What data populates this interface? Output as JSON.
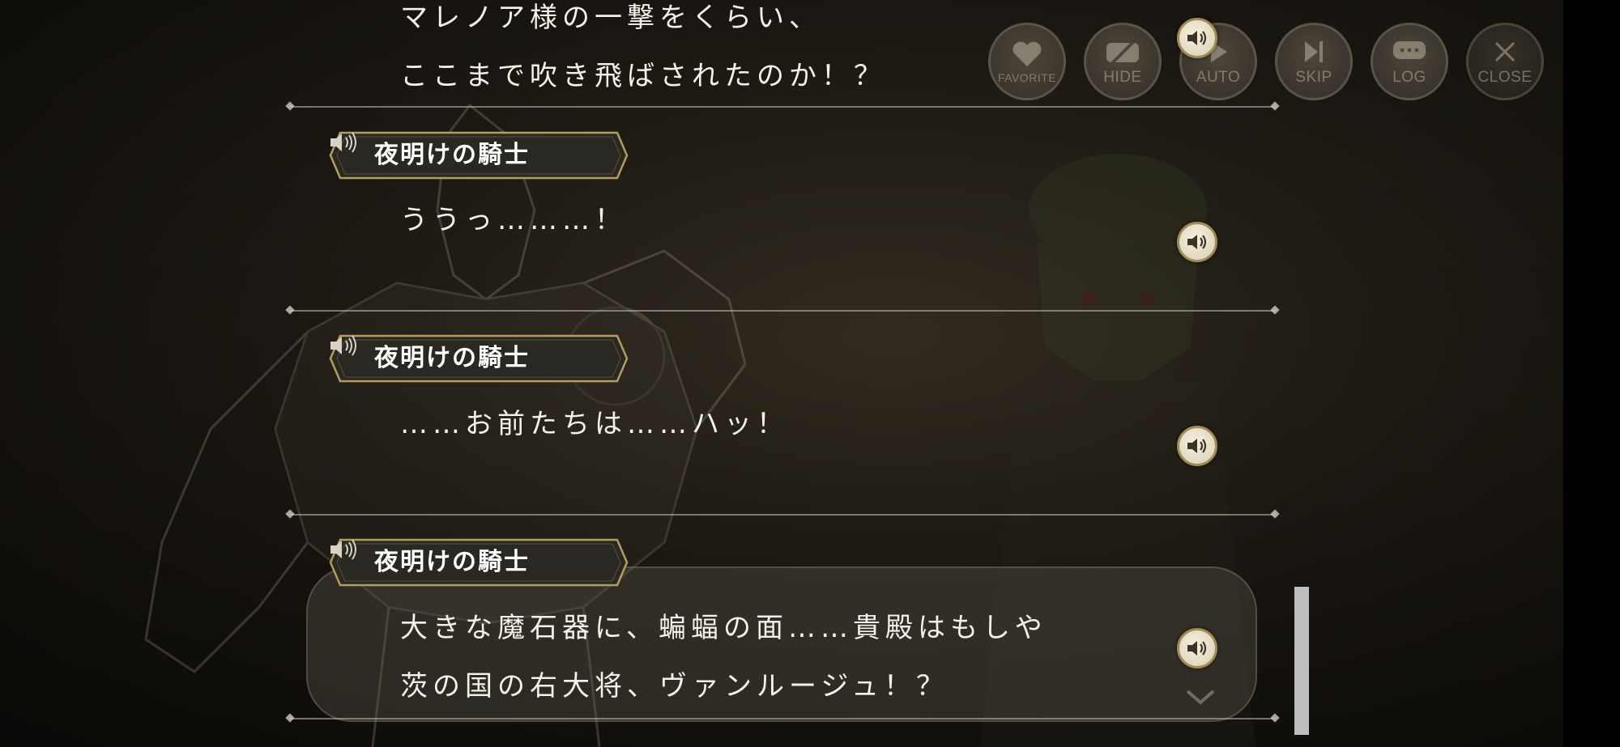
{
  "toolbar": {
    "favorite": "FAVORITE",
    "hide": "HIDE",
    "auto": "AUTO",
    "skip": "SKIP",
    "log": "LOG",
    "close": "CLOSE"
  },
  "log": {
    "entry0": {
      "line1": "マレノア様の一撃をくらい、",
      "line2": "ここまで吹き飛ばされたのか！？"
    },
    "entry1": {
      "speaker": "夜明けの騎士",
      "line1": "ううっ………！"
    },
    "entry2": {
      "speaker": "夜明けの騎士",
      "line1": "……お前たちは……ハッ！"
    },
    "entry3": {
      "speaker": "夜明けの騎士",
      "line1": "大きな魔石器に、蝙蝠の面……貴殿はもしや",
      "line2": "茨の国の右大将、ヴァンルージュ！？"
    }
  },
  "icons": {
    "favorite": "heart-icon",
    "hide": "eye-slash-icon",
    "auto": "play-icon",
    "skip": "skip-icon",
    "log": "speech-bubble-icon",
    "close": "close-icon",
    "voice": "speaker-icon"
  },
  "colors": {
    "gold": "#a08a57",
    "text": "#f4f1ea"
  }
}
